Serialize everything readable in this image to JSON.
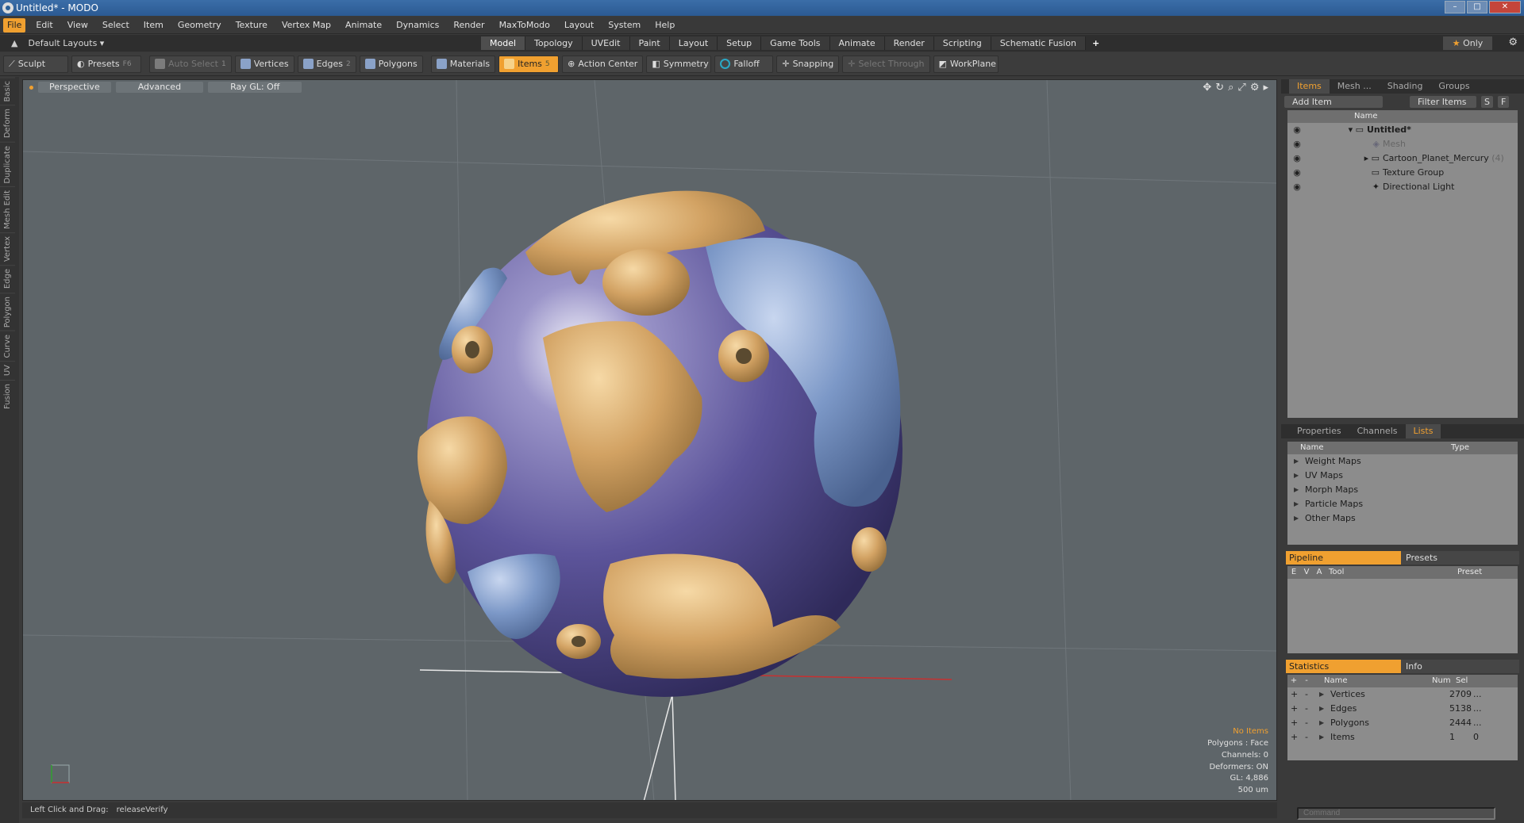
{
  "window": {
    "title": "Untitled* - MODO"
  },
  "menu": [
    "File",
    "Edit",
    "View",
    "Select",
    "Item",
    "Geometry",
    "Texture",
    "Vertex Map",
    "Animate",
    "Dynamics",
    "Render",
    "MaxToModo",
    "Layout",
    "System",
    "Help"
  ],
  "layouts": {
    "label": "Default Layouts ▾"
  },
  "mode_tabs": [
    "Model",
    "Topology",
    "UVEdit",
    "Paint",
    "Layout",
    "Setup",
    "Game Tools",
    "Animate",
    "Render",
    "Scripting",
    "Schematic Fusion"
  ],
  "only_label": "Only",
  "toolbar": {
    "sculpt": "Sculpt",
    "presets": "Presets",
    "presets_key": "F6",
    "auto_select": "Auto Select",
    "vertices": "Vertices",
    "vertices_key": "1",
    "edges": "Edges",
    "edges_key": "2",
    "polygons": "Polygons",
    "materials": "Materials",
    "items": "Items",
    "items_key": "5",
    "action_center": "Action Center",
    "symmetry": "Symmetry",
    "falloff": "Falloff",
    "snapping": "Snapping",
    "select_through": "Select Through",
    "workplane": "WorkPlane"
  },
  "left_tabs": [
    "Basic",
    "Deform",
    "Duplicate",
    "Mesh Edit",
    "Vertex",
    "Edge",
    "Polygon",
    "Curve",
    "UV",
    "Fusion"
  ],
  "viewport": {
    "view": "Perspective",
    "style": "Advanced",
    "raygl": "Ray GL: Off",
    "info": {
      "no_items": "No Items",
      "polygons": "Polygons : Face",
      "channels": "Channels: 0",
      "deformers": "Deformers: ON",
      "gl": "GL: 4,886",
      "scale": "500 um"
    }
  },
  "status": {
    "label": "Left Click and Drag:",
    "value": "releaseVerify"
  },
  "items_panel": {
    "tabs": [
      "Items",
      "Mesh ...",
      "Shading",
      "Groups"
    ],
    "add_item": "Add Item",
    "filter": "Filter Items",
    "s": "S",
    "f": "F",
    "name_header": "Name",
    "tree": [
      {
        "label": "Untitled*"
      },
      {
        "label": "Mesh"
      },
      {
        "label": "Cartoon_Planet_Mercury",
        "count": "(4)"
      },
      {
        "label": "Texture Group"
      },
      {
        "label": "Directional Light"
      }
    ]
  },
  "lists_panel": {
    "tabs": [
      "Properties",
      "Channels",
      "Lists"
    ],
    "name_header": "Name",
    "type_header": "Type",
    "rows": [
      "Weight Maps",
      "UV Maps",
      "Morph Maps",
      "Particle Maps",
      "Other Maps"
    ]
  },
  "pipeline_panel": {
    "tab_on": "Pipeline",
    "tab_off": "Presets",
    "headers": [
      "E",
      "V",
      "A",
      "Tool",
      "Preset"
    ]
  },
  "statistics_panel": {
    "tab_on": "Statistics",
    "tab_off": "Info",
    "headers": {
      "name": "Name",
      "num": "Num",
      "sel": "Sel"
    },
    "rows": [
      {
        "name": "Vertices",
        "num": "2709",
        "sel": "..."
      },
      {
        "name": "Edges",
        "num": "5138",
        "sel": "..."
      },
      {
        "name": "Polygons",
        "num": "2444",
        "sel": "..."
      },
      {
        "name": "Items",
        "num": "1",
        "sel": "0"
      }
    ]
  },
  "command": {
    "placeholder": "Command"
  }
}
